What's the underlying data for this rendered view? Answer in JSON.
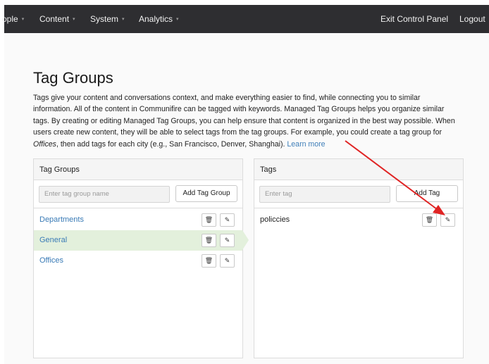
{
  "nav": {
    "left": [
      {
        "label": "ople",
        "caret": "▾"
      },
      {
        "label": "Content",
        "caret": "▾"
      },
      {
        "label": "System",
        "caret": "▾"
      },
      {
        "label": "Analytics",
        "caret": "▾"
      }
    ],
    "right": [
      {
        "label": "Exit Control Panel"
      },
      {
        "label": "Logout"
      }
    ]
  },
  "page": {
    "title": "Tag Groups",
    "intro": {
      "part1": "Tags give your content and conversations context, and make everything easier to find, while connecting you to similar information. All of the content in Communifire can be tagged with keywords. Managed Tag Groups helps you organize similar tags. By creating or editing Managed Tag Groups, you can help ensure that content is organized in the best way possible. When users create new content, they will be able to select tags from the tag groups. For example, you could create a tag group for ",
      "emphasis": "Offices",
      "part2": ", then add tags for each city (e.g., San Francisco, Denver, Shanghai). ",
      "learn_more": "Learn more"
    }
  },
  "tag_groups_panel": {
    "title": "Tag Groups",
    "input_placeholder": "Enter tag group name",
    "add_button": "Add Tag Group",
    "items": [
      {
        "label": "Departments"
      },
      {
        "label": "General"
      },
      {
        "label": "Offices"
      }
    ],
    "active_index": 1
  },
  "tags_panel": {
    "title": "Tags",
    "input_placeholder": "Enter tag",
    "add_button": "Add Tag",
    "items": [
      {
        "label": "policcies"
      }
    ]
  },
  "icons": {
    "delete": "trash-icon",
    "edit": "edit-icon",
    "delete_glyph": "🗑",
    "edit_glyph": "✎"
  },
  "colors": {
    "navbar": "#2e2e31",
    "link": "#3a7bb6",
    "active_row": "#e3f0dc",
    "annotation_arrow": "#e02424"
  }
}
